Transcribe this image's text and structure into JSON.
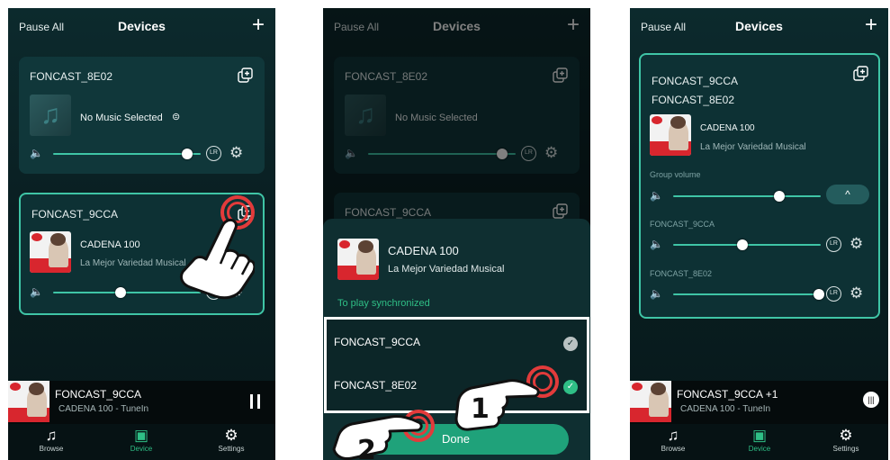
{
  "topbar": {
    "pause_all": "Pause All",
    "title": "Devices",
    "add": "+"
  },
  "screen1": {
    "card1": {
      "name": "FONCAST_8E02",
      "status": "No Music Selected",
      "spotify": "⊜"
    },
    "card2": {
      "name": "FONCAST_9CCA",
      "station": "CADENA 100",
      "subtitle": "La Mejor Variedad Musical"
    },
    "volumes": {
      "card1": 0.91,
      "card2": 0.46
    }
  },
  "screen2": {
    "card1": {
      "name": "FONCAST_8E02",
      "status": "No Music Selected"
    },
    "card2_name": "FONCAST_9CCA",
    "sheet": {
      "station": "CADENA 100",
      "subtitle": "La Mejor Variedad Musical",
      "sync_label": "To play synchronized",
      "devices": [
        "FONCAST_9CCA",
        "FONCAST_8E02"
      ],
      "done": "Done"
    },
    "steps": [
      "1",
      "2"
    ]
  },
  "screen3": {
    "group_names": [
      "FONCAST_9CCA",
      "FONCAST_8E02"
    ],
    "station": "CADENA 100",
    "subtitle": "La Mejor Variedad Musical",
    "group_volume_label": "Group volume",
    "member1": "FONCAST_9CCA",
    "member2": "FONCAST_8E02",
    "volumes": {
      "group": 0.72,
      "member1": 0.47,
      "member2": 0.99
    }
  },
  "nowplaying": {
    "device": "FONCAST_9CCA",
    "device_group": "FONCAST_9CCA  +1",
    "source": "CADENA 100 - TuneIn"
  },
  "tabs": {
    "browse": "Browse",
    "device": "Device",
    "settings": "Settings"
  },
  "art_text": {
    "radio_caption": "La mejor variedad musical"
  },
  "colors": {
    "accent": "#3fc5a6",
    "green": "#2fbf86",
    "highlight": "#e23b3b"
  },
  "icons": {
    "speaker": "🔈",
    "gear": "⚙",
    "lr": "LR",
    "music_note": "♫",
    "check": "✓",
    "up": "^"
  }
}
